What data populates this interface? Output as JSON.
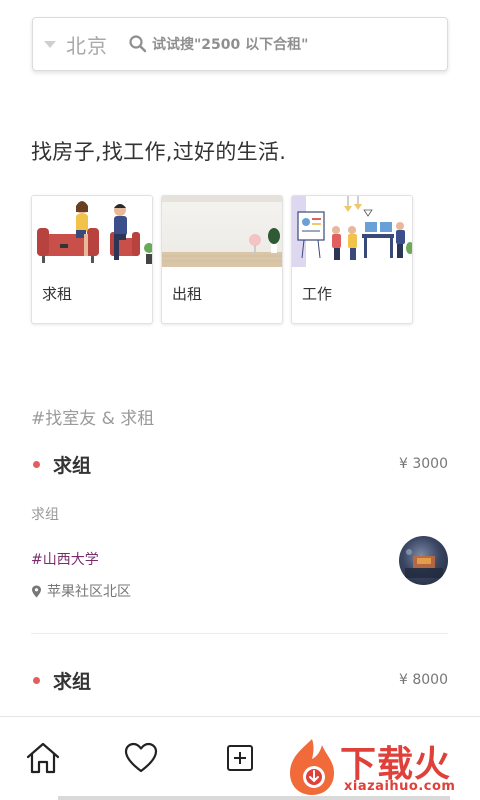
{
  "search": {
    "city": "北京",
    "hint": "试试搜\"2500 以下合租\""
  },
  "tagline": "找房子,找工作,过好的生活.",
  "categories": [
    {
      "label": "求租"
    },
    {
      "label": "出租"
    },
    {
      "label": "工作"
    }
  ],
  "section_header": "#找室友 & 求租",
  "listings": [
    {
      "title": "求组",
      "price": "¥ 3000",
      "desc": "求组",
      "school_tag": "#山西大学",
      "location": "苹果社区北区"
    },
    {
      "title": "求组",
      "price": "¥ 8000"
    }
  ],
  "nav": {
    "items": [
      "home-icon",
      "heart-icon",
      "add-icon"
    ]
  },
  "watermark": {
    "text": "下载火",
    "url": "xiazaihuo.com"
  },
  "colors": {
    "accent_dot": "#e06060",
    "tag_purple": "#7a2d6d",
    "watermark_red": "#e0403a"
  }
}
